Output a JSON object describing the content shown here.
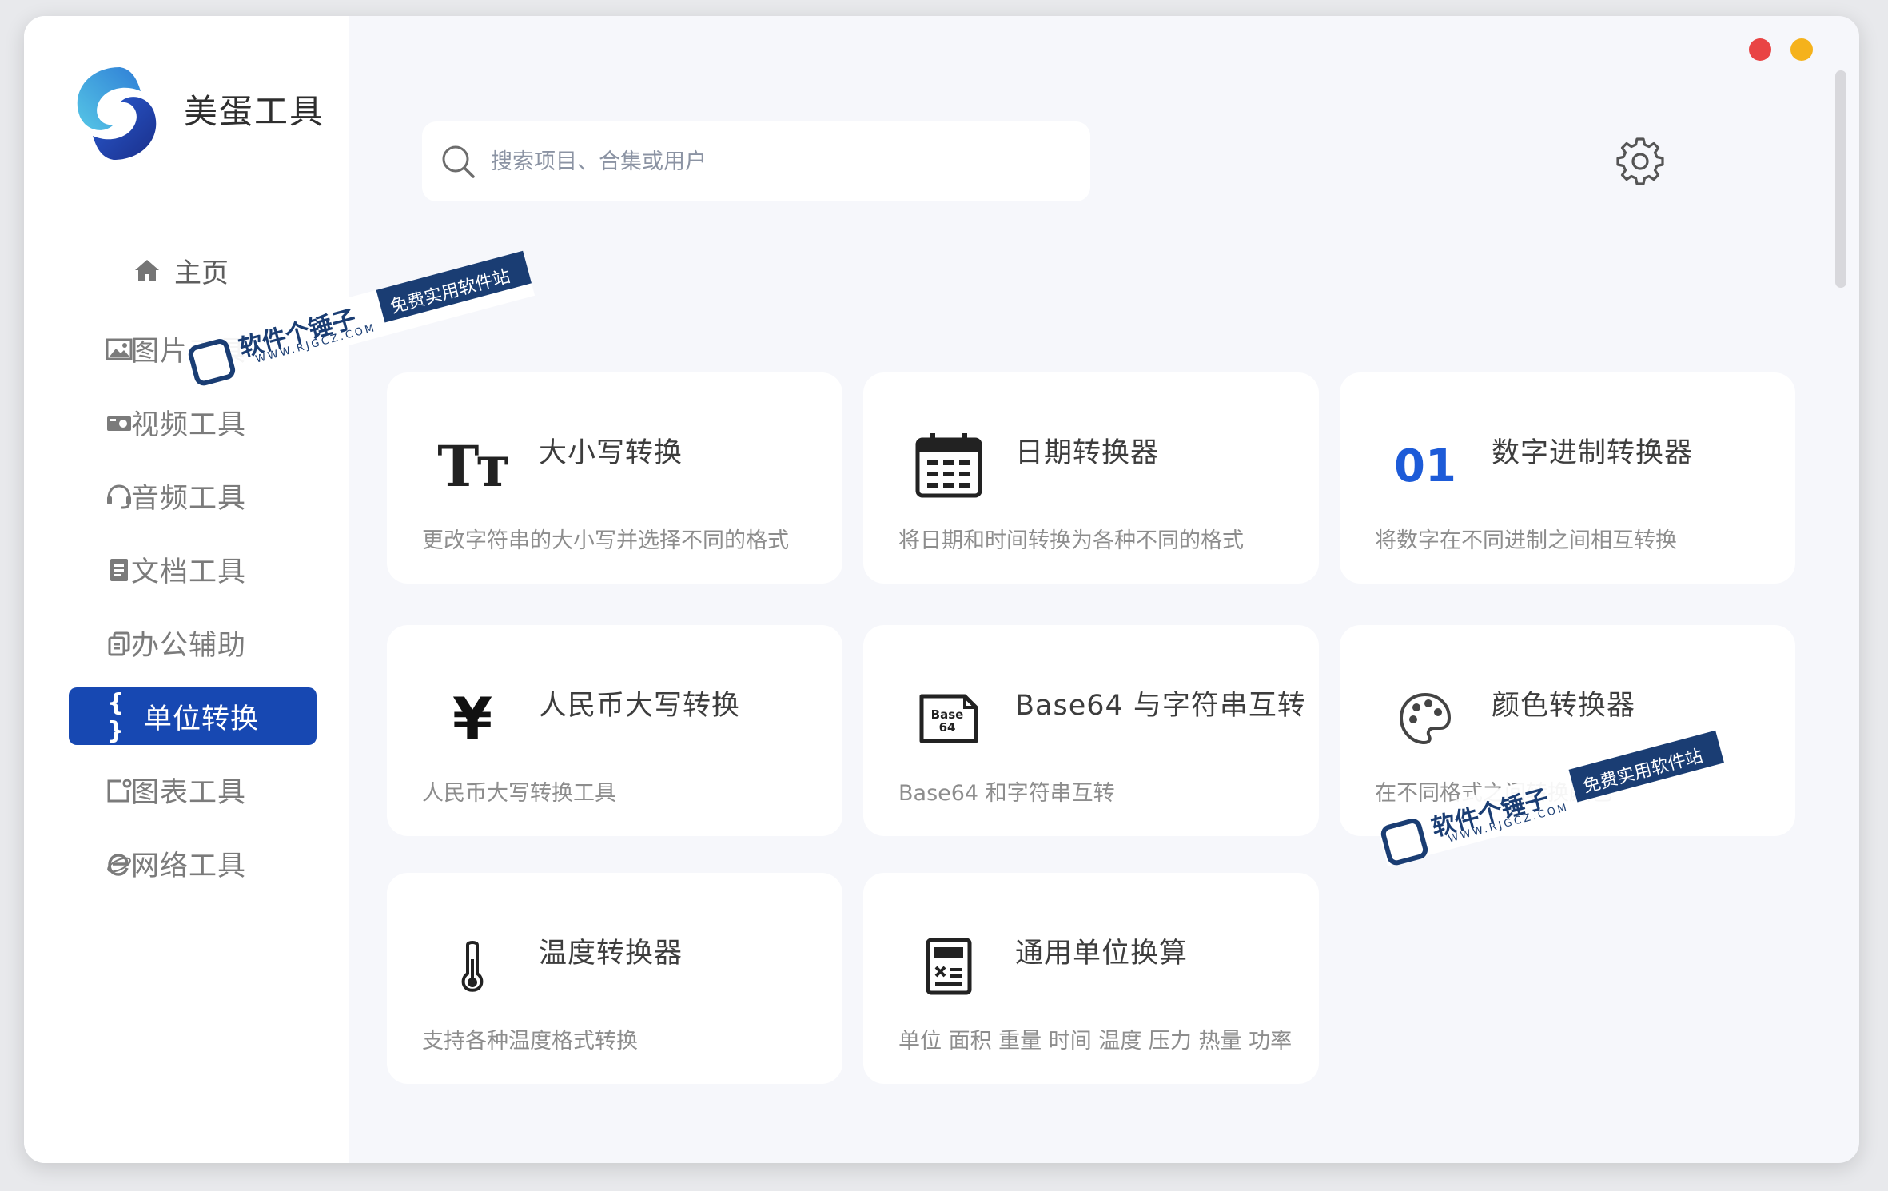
{
  "app": {
    "name": "美蛋工具"
  },
  "home": {
    "label": "主页"
  },
  "sidebar": {
    "items": [
      {
        "label": "图片工具",
        "icon": "image-icon"
      },
      {
        "label": "视频工具",
        "icon": "video-icon"
      },
      {
        "label": "音频工具",
        "icon": "headset-icon"
      },
      {
        "label": "文档工具",
        "icon": "document-icon"
      },
      {
        "label": "办公辅助",
        "icon": "copy-icon"
      },
      {
        "label": "单位转换",
        "icon": "braces-icon",
        "active": true
      },
      {
        "label": "图表工具",
        "icon": "chart-icon"
      },
      {
        "label": "网络工具",
        "icon": "browser-icon"
      }
    ]
  },
  "search": {
    "placeholder": "搜索项目、合集或用户"
  },
  "cards": [
    {
      "title": "大小写转换",
      "desc": "更改字符串的大小写并选择不同的格式",
      "icon": "text-case-icon",
      "icon_text": "Tт"
    },
    {
      "title": "日期转换器",
      "desc": "将日期和时间转换为各种不同的格式",
      "icon": "calendar-icon"
    },
    {
      "title": "数字进制转换器",
      "desc": "将数字在不同进制之间相互转换",
      "icon": "binary-icon",
      "icon_text": "01"
    },
    {
      "title": "人民币大写转换",
      "desc": "人民币大写转换工具",
      "icon": "yen-icon",
      "icon_text": "¥"
    },
    {
      "title": "Base64 与字符串互转",
      "desc": "Base64 和字符串互转",
      "icon": "base64-file-icon",
      "icon_text": "Base 64"
    },
    {
      "title": "颜色转换器",
      "desc": "在不同格式之间转换颜色",
      "icon": "palette-icon"
    },
    {
      "title": "温度转换器",
      "desc": "支持各种温度格式转换",
      "icon": "thermometer-icon"
    },
    {
      "title": "通用单位换算",
      "desc": "单位 面积 重量 时间 温度 压力 热量 功率",
      "icon": "calculator-icon"
    }
  ],
  "watermark": {
    "name": "软件个锤子",
    "slogan": "免费实用软件站",
    "url": "WWW.RJGCZ.COM"
  },
  "colors": {
    "accent": "#1748b2",
    "close": "#e94444",
    "minimize": "#f5b21b"
  }
}
